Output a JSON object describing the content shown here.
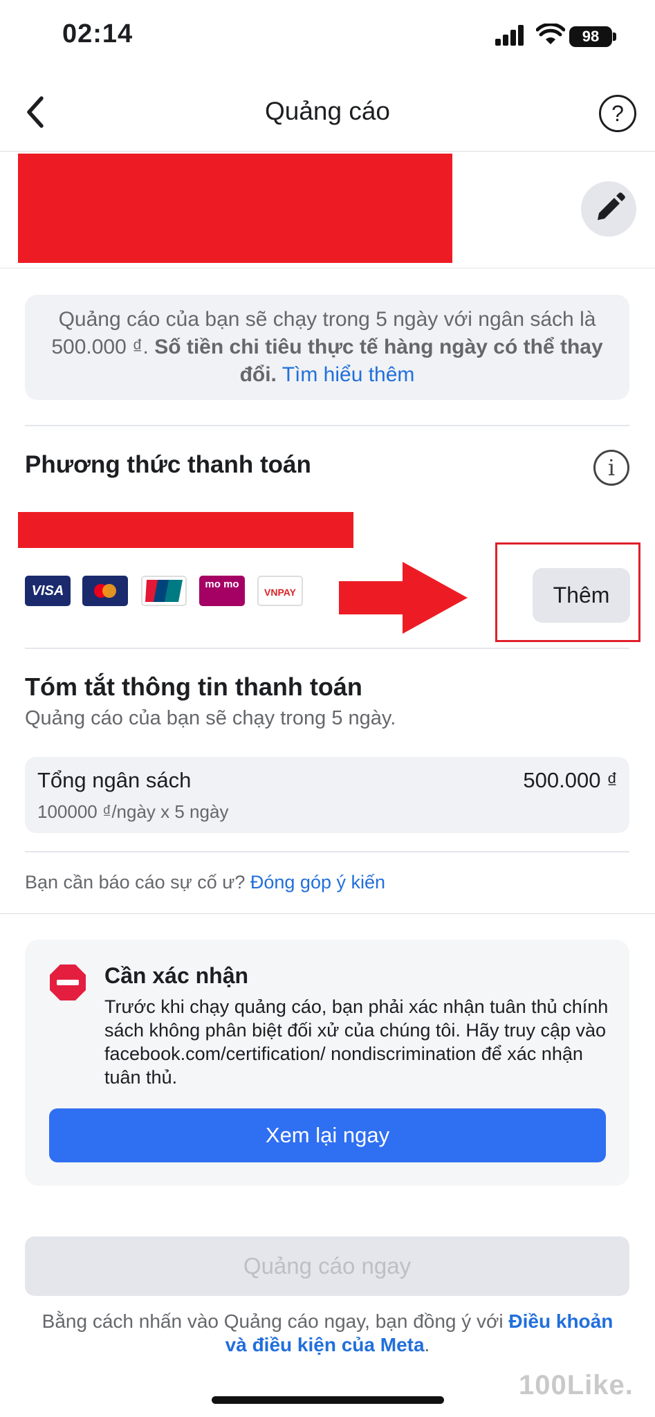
{
  "status_bar": {
    "time": "02:14",
    "battery": "98"
  },
  "header": {
    "title": "Quảng cáo",
    "help_symbol": "?"
  },
  "budget_notice": {
    "text_plain": "Quảng cáo của bạn sẽ chạy trong 5 ngày với ngân sách là 500.000 ₫.",
    "text_bold": "Số tiền chi tiêu thực tế hàng ngày có thể thay đổi.",
    "link": "Tìm hiểu thêm"
  },
  "payment_method": {
    "title": "Phương thức thanh toán",
    "cards": [
      {
        "name": "VISA"
      },
      {
        "name": "Mastercard"
      },
      {
        "name": "UnionPay"
      },
      {
        "name": "mo mo"
      },
      {
        "name": "VNPAY"
      }
    ],
    "add_label": "Thêm"
  },
  "summary": {
    "title": "Tóm tắt thông tin thanh toán",
    "subtitle": "Quảng cáo của bạn sẽ chạy trong 5 ngày.",
    "total_label": "Tổng ngân sách",
    "total_value": "500.000 ₫",
    "calculation": "100000 ₫/ngày x 5 ngày"
  },
  "feedback": {
    "question": "Bạn cần báo cáo sự cố ư?",
    "link": "Đóng góp ý kiến"
  },
  "confirmation": {
    "title": "Cần xác nhận",
    "body": "Trước khi chạy quảng cáo, bạn phải xác nhận tuân thủ chính sách không phân biệt đối xử của chúng tôi. Hãy truy cập vào facebook.com/certification/ nondiscrimination để xác nhận tuân thủ.",
    "button": "Xem lại ngay"
  },
  "footer": {
    "ad_now_button": "Quảng cáo ngay",
    "terms_plain": "Bằng cách nhấn vào Quảng cáo ngay, bạn đồng ý với",
    "terms_link": "Điều khoản và điều kiện của Meta",
    "terms_end": "."
  },
  "watermark": "100Like.",
  "colors": {
    "accent_blue": "#2f6ff2",
    "link_blue": "#216fdb",
    "redaction_red": "#ed1c24",
    "stop_red": "#e41e3f"
  }
}
